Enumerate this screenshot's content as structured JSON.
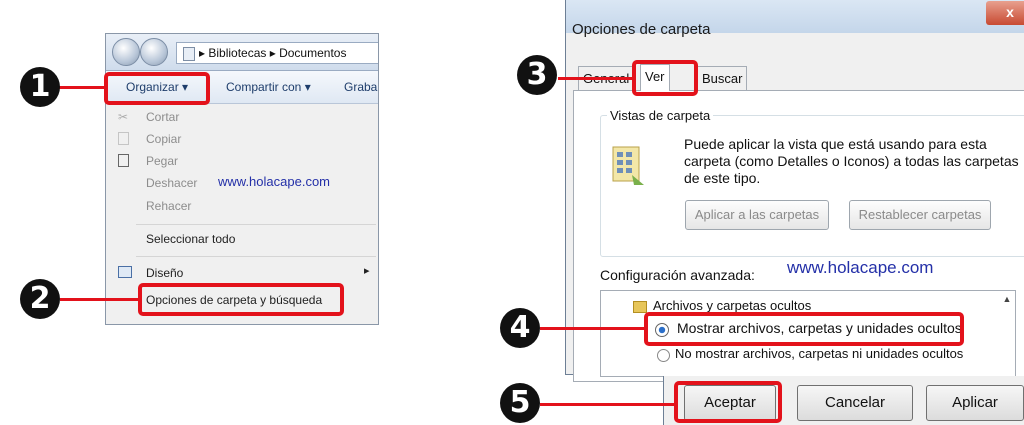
{
  "explorer": {
    "address_path": "▸ Bibliotecas ▸ Documentos",
    "toolbar": {
      "organize_label": "Organizar ▾",
      "share_label": "Compartir con ▾",
      "burn_label": "Graba"
    },
    "menu": {
      "cut": "Cortar",
      "copy": "Copiar",
      "paste": "Pegar",
      "undo": "Deshacer",
      "redo": "Rehacer",
      "select_all": "Seleccionar todo",
      "layout": "Diseño",
      "layout_arrow": "▸",
      "folder_options": "Opciones de carpeta y búsqueda"
    },
    "watermark": "www.holacape.com"
  },
  "dialog": {
    "title": "Opciones de carpeta",
    "close_label": "x",
    "tabs": [
      "General",
      "Ver",
      "Buscar"
    ],
    "group_title": "Vistas de carpeta",
    "group_description": "Puede aplicar la vista que está usando para esta carpeta (como Detalles o Iconos) a todas las carpetas de este tipo.",
    "apply_to_folders": "Aplicar a las carpetas",
    "reset_folders": "Restablecer carpetas",
    "advanced_label": "Configuración avanzada:",
    "watermark": "www.holacape.com",
    "advanced_items": {
      "hidden_files": "Archivos y carpetas ocultos",
      "show_hidden": "Mostrar archivos, carpetas y unidades ocultos",
      "dont_show_hidden": "No mostrar archivos, carpetas ni unidades ocultos"
    },
    "buttons": {
      "ok": "Aceptar",
      "cancel": "Cancelar",
      "apply": "Aplicar"
    }
  },
  "callouts": [
    "1",
    "2",
    "3",
    "4",
    "5"
  ],
  "colors": {
    "highlight": "#e3121b",
    "badge": "#111111",
    "watermark": "#2430a8"
  }
}
